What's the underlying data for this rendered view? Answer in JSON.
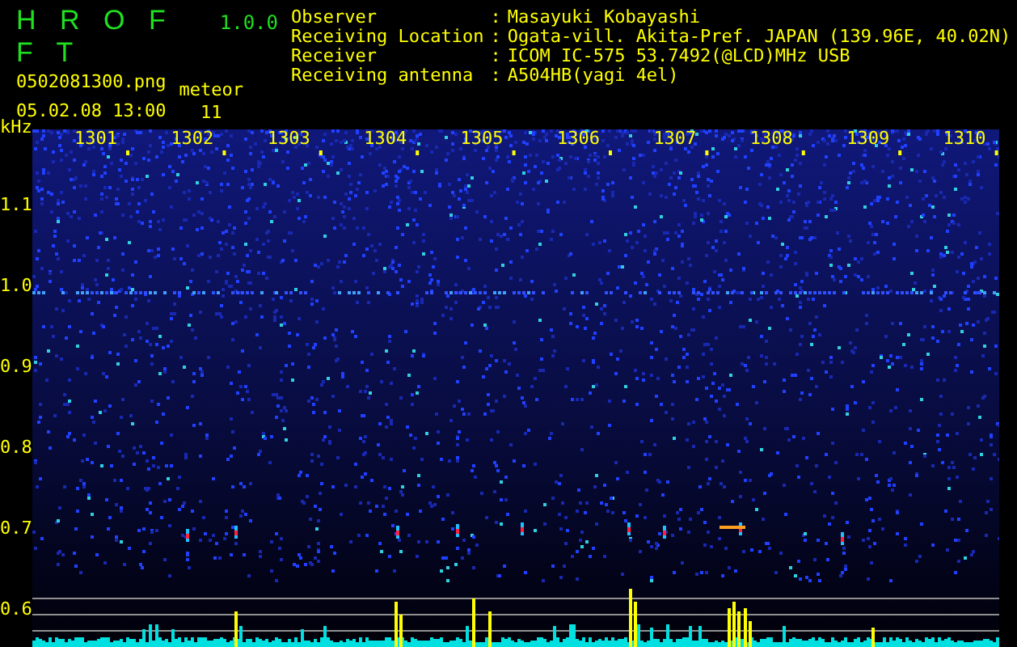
{
  "app": {
    "name": "H R O F F T",
    "version": "1.0.0"
  },
  "file": "0502081300.png",
  "datetime": "05.02.08 13:00",
  "meteor": {
    "label": "meteor",
    "count": "11"
  },
  "info": [
    {
      "label": "Observer",
      "colon": ":",
      "value": "Masayuki Kobayashi"
    },
    {
      "label": "Receiving Location",
      "colon": ":",
      "value": "Ogata-vill. Akita-Pref. JAPAN (139.96E, 40.02N)"
    },
    {
      "label": "Receiver",
      "colon": ":",
      "value": "ICOM IC-575 53.7492(@LCD)MHz USB"
    },
    {
      "label": "Receiving antenna",
      "colon": ":",
      "value": "A504HB(yagi 4el)"
    }
  ],
  "spectrogram": {
    "y_unit": "kHz",
    "y_labels": [
      "1.1",
      "1.0",
      "0.9",
      "0.8",
      "0.7",
      "0.6"
    ],
    "x_labels": [
      "1301",
      "1302",
      "1303",
      "1304",
      "1305",
      "1306",
      "1307",
      "1308",
      "1309",
      "1310"
    ]
  }
}
